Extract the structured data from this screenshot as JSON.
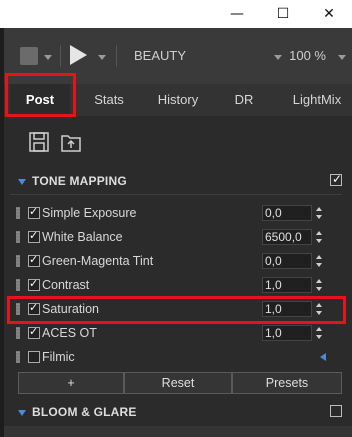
{
  "window": {
    "minimize_glyph": "—",
    "maximize_glyph": "☐",
    "close_glyph": "✕"
  },
  "toolbar": {
    "pass_name": "BEAUTY",
    "zoom": "100 %"
  },
  "tabs": [
    {
      "label": "Post",
      "active": true
    },
    {
      "label": "Stats",
      "active": false
    },
    {
      "label": "History",
      "active": false
    },
    {
      "label": "DR",
      "active": false
    },
    {
      "label": "LightMix",
      "active": false
    }
  ],
  "icons": [
    "save-icon",
    "load-icon"
  ],
  "tone_mapping": {
    "title": "TONE MAPPING",
    "enabled": true,
    "items": [
      {
        "label": "Simple Exposure",
        "checked": true,
        "value": "0,0"
      },
      {
        "label": "White Balance",
        "checked": true,
        "value": "6500,0"
      },
      {
        "label": "Green-Magenta Tint",
        "checked": true,
        "value": "0,0"
      },
      {
        "label": "Contrast",
        "checked": true,
        "value": "1,0"
      },
      {
        "label": "Saturation",
        "checked": true,
        "value": "1,0"
      },
      {
        "label": "ACES OT",
        "checked": true,
        "value": "1,0"
      },
      {
        "label": "Filmic",
        "checked": false,
        "value": ""
      }
    ]
  },
  "buttons": {
    "add": "+",
    "reset": "Reset",
    "presets": "Presets"
  },
  "bloom": {
    "title": "BLOOM & GLARE",
    "enabled": false
  },
  "colors": {
    "highlight": "#e3141b",
    "accent": "#4a8ad8"
  }
}
